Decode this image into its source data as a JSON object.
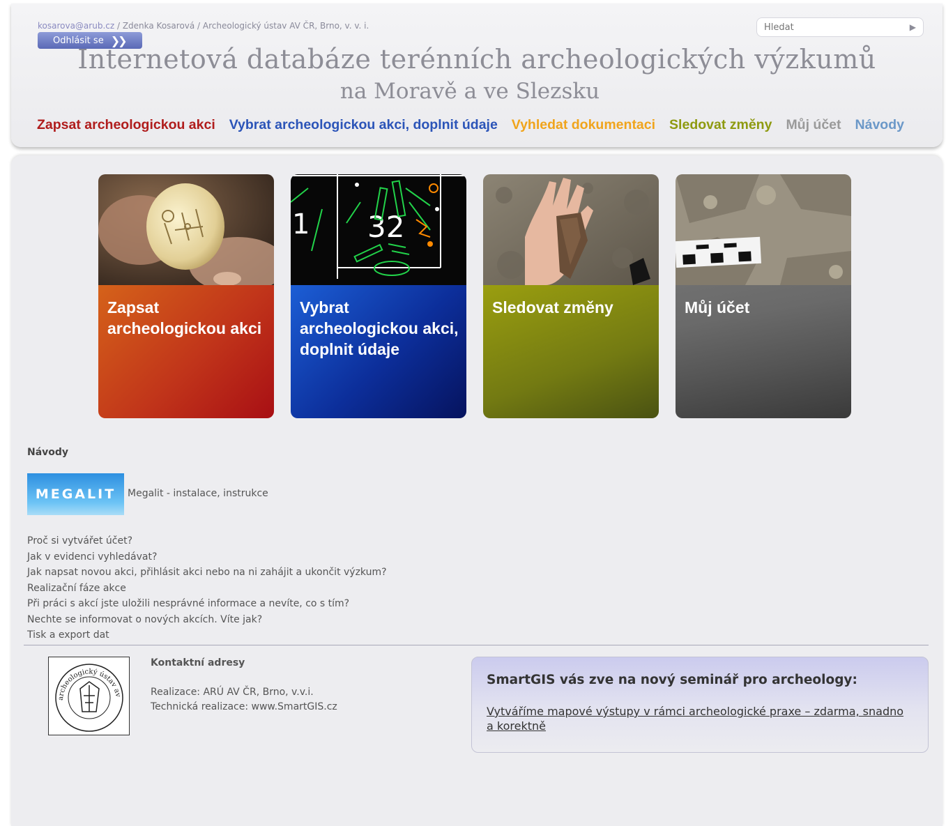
{
  "header": {
    "user_email": "kosarova@arub.cz",
    "user_rest": " / Zdenka Kosarová / Archeologický ústav AV ČR, Brno, v. v. i.",
    "logout_label": "Odhlásit se",
    "search_placeholder": "Hledat",
    "title_line1": "Internetová databáze terénních archeologických výzkumů",
    "title_line2": "na Moravě a ve Slezsku"
  },
  "nav": [
    {
      "label": "Zapsat archeologickou akci",
      "color": "#b01c1c"
    },
    {
      "label": "Vybrat archeologickou akci, doplnit údaje",
      "color": "#2b54b8"
    },
    {
      "label": "Vyhledat dokumentaci",
      "color": "#f0a41c"
    },
    {
      "label": "Sledovat změny",
      "color": "#8e9a10"
    },
    {
      "label": "Můj účet",
      "color": "#9a9a9a"
    },
    {
      "label": "Návody",
      "color": "#6b98c8"
    }
  ],
  "tiles": [
    {
      "label": "Zapsat archeologickou akci"
    },
    {
      "label": "Vybrat archeologickou akci, doplnit údaje"
    },
    {
      "label": "Sledovat změny"
    },
    {
      "label": "Můj účet"
    }
  ],
  "guides": {
    "title": "Návody",
    "megalit_logo": "MEGALIT",
    "megalit_text": "Megalit - instalace, instrukce",
    "links": [
      "Proč si vytvářet účet?",
      "Jak v evidenci vyhledávat?",
      "Jak napsat novou akci, přihlásit akci nebo na ni zahájit a ukončit výzkum?",
      "Realizační fáze akce",
      "Při práci s akcí jste uložili nesprávné informace a nevíte, co s tím?",
      "Nechte se informovat o nových akcích. Víte jak?",
      "Tisk a export dat"
    ]
  },
  "footer": {
    "seal_text": "archeologický ústav av čr v brně",
    "contact_title": "Kontaktní adresy",
    "contact_line1": "Realizace: ARÚ AV ČR, Brno, v.v.i.",
    "contact_line2": "Technická realizace: www.SmartGIS.cz",
    "promo_title": "SmartGIS vás zve na nový seminář pro archeology:",
    "promo_link": "Vytváříme mapové výstupy v rámci archeologické praxe – zdarma, snadno a korektně"
  }
}
